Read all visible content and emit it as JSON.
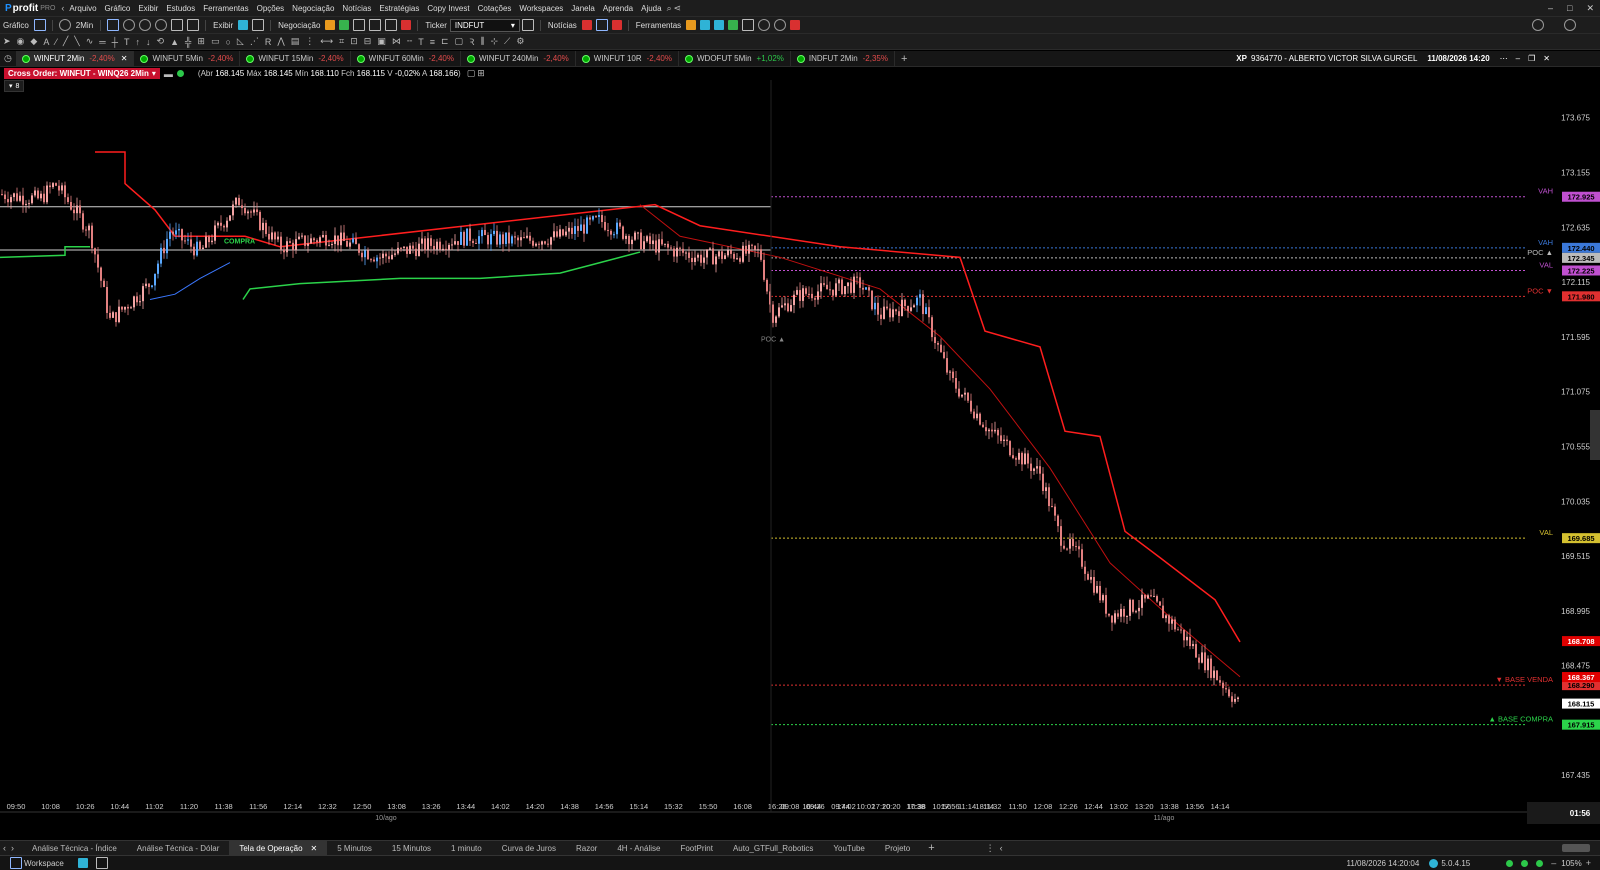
{
  "app": {
    "name": "profit",
    "edition": "PRO"
  },
  "menu": [
    "Arquivo",
    "Gráfico",
    "Exibir",
    "Estudos",
    "Ferramentas",
    "Opções",
    "Negociação",
    "Notícias",
    "Estratégias",
    "Copy Invest",
    "Cotações",
    "Workspaces",
    "Janela",
    "Aprenda",
    "Ajuda"
  ],
  "toolbar": {
    "grafico": "Gráfico",
    "timeframe": "2Min",
    "exibir": "Exibir",
    "negociacao": "Negociação",
    "ticker_label": "Ticker",
    "ticker_value": "INDFUT",
    "noticias": "Notícias",
    "ferramentas": "Ferramentas"
  },
  "tabs": [
    {
      "label": "WINFUT 2Min",
      "change": "-2,40%",
      "active": true
    },
    {
      "label": "WINFUT 5Min",
      "change": "-2,40%"
    },
    {
      "label": "WINFUT 15Min",
      "change": "-2,40%"
    },
    {
      "label": "WINFUT 60Min",
      "change": "-2,40%"
    },
    {
      "label": "WINFUT 240Min",
      "change": "-2,40%"
    },
    {
      "label": "WINFUT 10R",
      "change": "-2,40%"
    },
    {
      "label": "WDOFUT 5Min",
      "change": "+1,02%"
    },
    {
      "label": "INDFUT 2Min",
      "change": "-2,35%"
    }
  ],
  "account": {
    "broker": "XP",
    "id": "9364770 - ALBERTO VICTOR SILVA GURGEL",
    "datetime": "11/08/2026 14:20"
  },
  "info": {
    "cross_order": "Cross Order: WINFUT - WINQ26 2Min",
    "abr_label": "Abr",
    "abr": "168.145",
    "max_label": "Máx",
    "max": "168.145",
    "min_label": "Mín",
    "min": "168.110",
    "fch_label": "Fch",
    "fch": "168.115",
    "var_label": "V",
    "var": "-0,02%",
    "a_label": "A",
    "a": "168.166",
    "counter": "8"
  },
  "chart_data": {
    "type": "candlestick",
    "ylim": [
      167.2,
      173.9
    ],
    "y_ticks": [
      "173.675",
      "173.155",
      "172.635",
      "172.115",
      "171.595",
      "171.075",
      "170.555",
      "170.035",
      "169.515",
      "168.995",
      "168.475",
      "167.435"
    ],
    "x_ticks": [
      "09:50",
      "10:08",
      "10:26",
      "10:44",
      "11:02",
      "11:20",
      "11:38",
      "11:56",
      "12:14",
      "12:32",
      "12:50",
      "13:08",
      "13:26",
      "13:44",
      "14:02",
      "14:20",
      "14:38",
      "14:56",
      "15:14",
      "15:32",
      "15:50",
      "16:08",
      "16:26",
      "16:44",
      "17:02",
      "17:20",
      "17:38",
      "17:56",
      "18:14",
      "09:08",
      "09:26",
      "09:44",
      "10:02",
      "10:20",
      "10:38",
      "10:56",
      "11:14",
      "11:32",
      "11:50",
      "12:08",
      "12:26",
      "12:44",
      "13:02",
      "13:20",
      "13:38",
      "13:56",
      "14:14"
    ],
    "date_labels": [
      "10/ago",
      "11/ago"
    ],
    "levels": [
      {
        "name": "VAH",
        "price": "172.925",
        "color": "#c050d0"
      },
      {
        "name": "VAH",
        "price": "172.440",
        "color": "#3b78d8"
      },
      {
        "name": "POC ▲",
        "price": "172.345",
        "color": "#bbbbbb"
      },
      {
        "name": "VAL",
        "price": "172.225",
        "color": "#c050d0"
      },
      {
        "name": "POC ▼",
        "price": "171.980",
        "color": "#e03030"
      },
      {
        "name": "VAL",
        "price": "169.685",
        "color": "#d4c030"
      },
      {
        "name": "▼ BASE VENDA",
        "price": "168.290",
        "color": "#e03030"
      },
      {
        "name": "▲ BASE COMPRA",
        "price": "167.915",
        "color": "#2bd34a"
      }
    ],
    "badges": [
      {
        "price": "168.708",
        "color": "#e00000"
      },
      {
        "price": "168.367",
        "color": "#e00000"
      },
      {
        "price": "168.115",
        "color": "#ffffff"
      }
    ],
    "annotations": {
      "compra": "COMPRA",
      "poc": "POC ▲"
    },
    "clock": "01:56"
  },
  "workspaces": [
    "Análise Técnica - Índice",
    "Análise Técnica - Dólar",
    "Tela de Operação",
    "5 Minutos",
    "15 Minutos",
    "1 minuto",
    "Curva de Juros",
    "Razor",
    "4H - Análise",
    "FootPrint",
    "Auto_GTFull_Robotics",
    "YouTube",
    "Projeto"
  ],
  "workspace_active": "Tela de Operação",
  "status": {
    "workspace": "Workspace",
    "datetime": "11/08/2026 14:20:04",
    "version": "5.0.4.15",
    "zoom": "105%"
  }
}
